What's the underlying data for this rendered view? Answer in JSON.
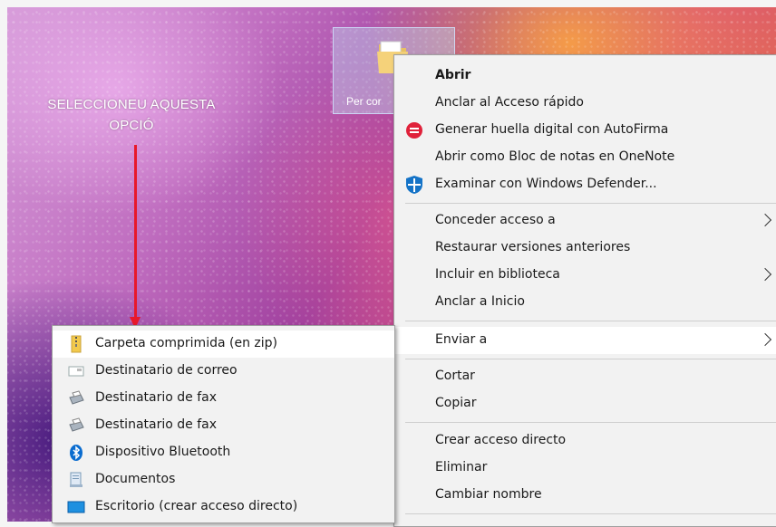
{
  "annotation": {
    "line1": "SELECCIONEU AQUESTA",
    "line2": "OPCIÓ",
    "arrow_color": "#e8182a"
  },
  "desktop": {
    "folder_label": "Per cor"
  },
  "context_menu": {
    "items": [
      {
        "label": "Abrir",
        "bold": true
      },
      {
        "label": "Anclar al Acceso rápido"
      },
      {
        "label": "Generar huella digital con AutoFirma",
        "icon": "autofirma-icon"
      },
      {
        "label": "Abrir como Bloc de notas en OneNote"
      },
      {
        "label": "Examinar con Windows Defender...",
        "icon": "windows-defender-icon"
      },
      {
        "label": "Conceder acceso a",
        "submenu": true
      },
      {
        "label": "Restaurar versiones anteriores"
      },
      {
        "label": "Incluir en biblioteca",
        "submenu": true
      },
      {
        "label": "Anclar a Inicio"
      },
      {
        "label": "Enviar a",
        "submenu": true,
        "highlighted": true
      },
      {
        "label": "Cortar"
      },
      {
        "label": "Copiar"
      },
      {
        "label": "Crear acceso directo"
      },
      {
        "label": "Eliminar"
      },
      {
        "label": "Cambiar nombre"
      }
    ]
  },
  "send_to_menu": {
    "items": [
      {
        "label": "Carpeta comprimida (en zip)",
        "icon": "zip-folder-icon",
        "highlighted": true
      },
      {
        "label": "Destinatario de correo",
        "icon": "mail-recipient-icon"
      },
      {
        "label": "Destinatario de fax",
        "icon": "fax-icon"
      },
      {
        "label": "Destinatario de fax",
        "icon": "fax-icon"
      },
      {
        "label": "Dispositivo Bluetooth",
        "icon": "bluetooth-icon"
      },
      {
        "label": "Documentos",
        "icon": "documents-icon"
      },
      {
        "label": "Escritorio (crear acceso directo)",
        "icon": "desktop-icon"
      }
    ]
  },
  "colors": {
    "menu_bg": "#f2f2f2",
    "hover_bg": "#ffffff",
    "autofirma_red": "#e0213a",
    "defender_blue": "#1473c7",
    "bluetooth_blue": "#0a6ccf"
  }
}
